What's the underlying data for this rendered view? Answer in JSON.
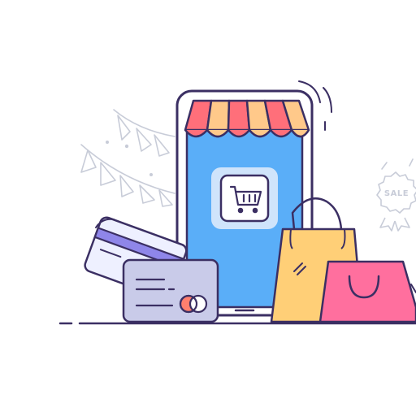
{
  "illustration": {
    "badge": {
      "text": "SALE"
    },
    "icons": {
      "store_app": "shopping-cart-icon",
      "awning": "striped-store-awning",
      "cards": "credit-card-icon",
      "bags": "shopping-bag-icon",
      "decor": "bunting-flags"
    },
    "colors": {
      "outline": "#3b2f63",
      "screen": "#5aaef8",
      "awning_red": "#ff6f7a",
      "awning_yellow": "#ffc98a",
      "card_front": "#c9cbe9",
      "card_back": "#eef0ff",
      "card_stripe": "#8f86e9",
      "bag_yellow": "#ffcf77",
      "bag_pink": "#ff6f9e",
      "coin": "#ff7f6e",
      "decor_gray": "#c8ccd8"
    }
  }
}
